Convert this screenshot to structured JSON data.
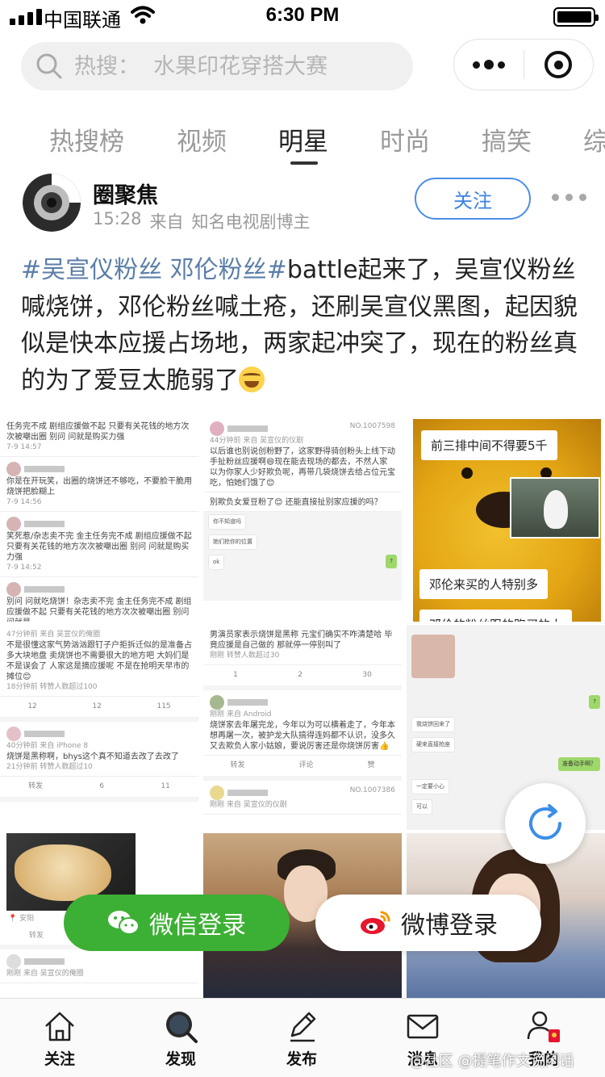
{
  "status_bar": {
    "carrier": "中国联通",
    "time": "6:30 PM"
  },
  "search": {
    "placeholder": "热搜：  水果印花穿搭大赛"
  },
  "tabs": [
    {
      "label": "热搜榜"
    },
    {
      "label": "视频"
    },
    {
      "label": "明星"
    },
    {
      "label": "时尚"
    },
    {
      "label": "搞笑"
    },
    {
      "label": "综"
    }
  ],
  "active_tab": "明星",
  "post": {
    "author": "圈聚焦",
    "time": "15:28",
    "source_prefix": "来自",
    "source": "知名电视剧博主",
    "follow_label": "关注",
    "hashtag": "#吴宣仪粉丝 邓伦粉丝#",
    "body": "battle起来了，吴宣仪粉丝喊烧饼，邓伦粉丝喊土疮，还刷吴宣仪黑图，起因貌似是快本应援占场地，两家起冲突了，现在的粉丝真的为了爱豆太脆弱了"
  },
  "images": {
    "shot1": {
      "rows": [
        {
          "text": "任务完不成 剧组应援做不起 只要有关花钱的地方次次被嘲出圈 别问 问就是购买力强",
          "time": "7-9 14:57"
        },
        {
          "text": "你是在开玩笑，出圈的烧饼还不够吃，不要脸干脆用烧饼把脸糊上",
          "time": "7-9 14:56"
        },
        {
          "text": "笑死惹/杂志卖不完 金主任务完不成 剧组应援做不起 只要有关花钱的地方次次被嘲出圈 别问 问就是购买力强",
          "time": "7-9 14:52"
        },
        {
          "text": "别问 问就吃烧饼！杂志卖不完 金主任务完不成 剧组应援做不起 只要有关花钱的地方次次被嘲出圈 别问 问就是",
          "time": ""
        }
      ]
    },
    "shot2": {
      "badge": "NO.1007598",
      "meta": "44分钟前  来自 吴宣仪的仪剧",
      "text": "以后谁也别说创粉野了，这家野得骑创粉头上线下动手扯粉丝应援啊😄现在能去现场的都去，不然人家以为你家人少好欺负呢，再带几袋烧饼去给占位元宝吃，怕她们饿了😊",
      "text2": "别欺负女爱豆粉了😊 还能直接扯别家应援的吗？",
      "chat_l1": "你不知道吗",
      "chat_l2": "她们抢你的位置",
      "chat_l3": "ok",
      "chat_r1": "?"
    },
    "shot3": {
      "meta": "47分钟前  来自 吴宣仪的俺圈",
      "text": "不是很懂这家气势汹汹跟钉子户拒拆迁似的是准备占多大块地盘 卖烧饼也不需要很大的地方吧 大妈们是不是误会了 人家这是摘应援呢 不是在抢明天早市的摊位😊",
      "time": "18分钟前  转赞人数超过100",
      "repost": "12",
      "comment": "12",
      "like": "115"
    },
    "shot4": {
      "text": "男演员家表示烧饼是黑称 元宝们确实不咋清楚哈 毕竟应援是自己做的 那就停一停别叫了",
      "time": "刚刚  转赞人数超过30",
      "repost": "1",
      "comment": "2",
      "like": "30"
    },
    "shot5": {
      "meta": "40分钟前  来自 iPhone 8",
      "text": "烧饼是黑称啊，bhys这个真不知道去改了去改了",
      "time": "21分钟前  转赞人数超过10",
      "repost": "转发",
      "comment": "6",
      "like": "11"
    },
    "shot6": {
      "meta": "刚刚  来自 Android",
      "text": "烧饼家去年屠完龙，今年以为可以横着走了，今年本想再屠一次，被护龙大队搞得连妈都不认识，没多久又去欺负人家小姑娘，要说厉害还是你烧饼厉害👍",
      "repost": "转发",
      "comment": "评论",
      "like": "赞"
    },
    "shot7": {
      "chat_r1": "?",
      "chat_l1": "我烧饼回来了",
      "chat_l2": "硬来直接抢座",
      "chat_r2": "准备动手啊？",
      "chat_l3": "一定要小心",
      "chat_l4": "可以"
    },
    "pooh": {
      "caption_top": "前三排中间不得要5千",
      "caption_mid": "邓伦来买的人特别多",
      "caption_bottom": "邓伦的粉丝跟的跑买的大"
    },
    "shot8": {
      "badge": "NO.1007386",
      "meta": "刚刚  来自 吴宣仪的仪剧"
    },
    "shot9": {
      "location": "安阳",
      "repost": "转发",
      "meta": "刚刚  来自 吴宣仪的俺圈"
    }
  },
  "login": {
    "wechat_label": "微信登录",
    "weibo_label": "微博登录"
  },
  "tabbar": [
    {
      "label": "关注"
    },
    {
      "label": "发现"
    },
    {
      "label": "发布"
    },
    {
      "label": "消息"
    },
    {
      "label": "我的"
    }
  ],
  "watermark": "@社区 @提笔作文说闲话",
  "colors": {
    "accent_blue": "#3c83e2",
    "hashtag": "#5b7ea8",
    "wechat_green": "#3cb034",
    "weibo_red": "#e6162d"
  }
}
